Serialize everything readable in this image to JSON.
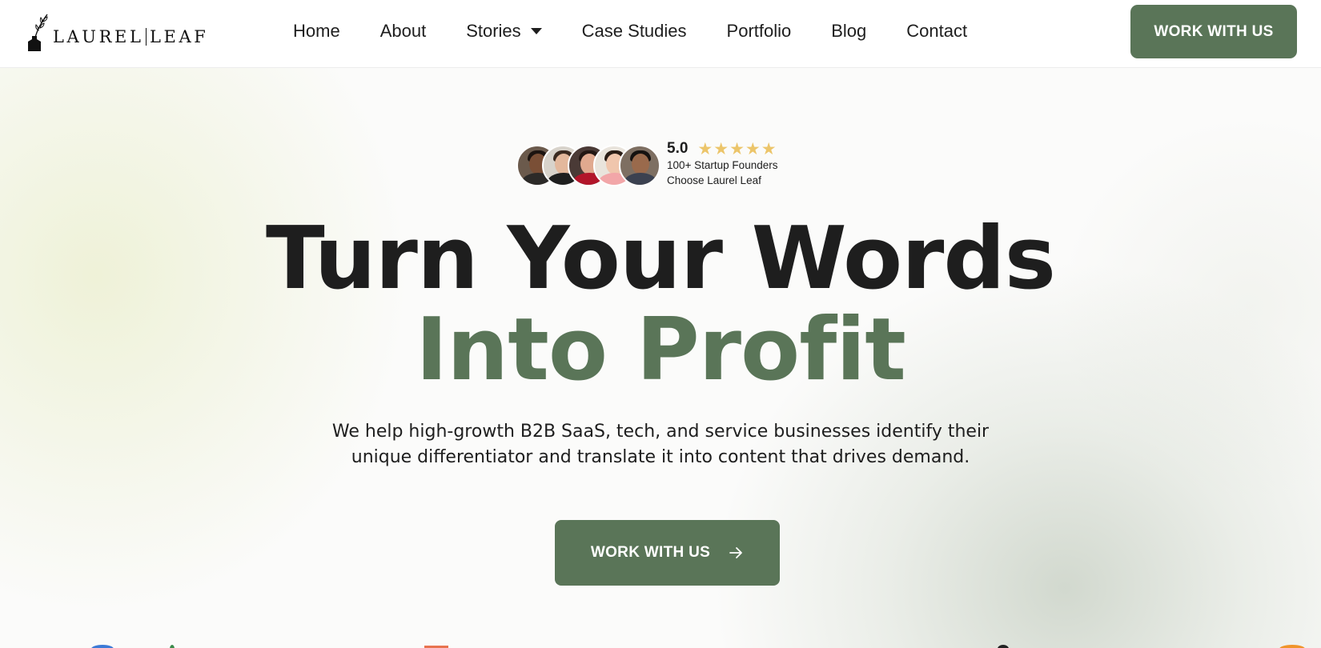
{
  "brand": {
    "name_left": "LAUREL",
    "name_right": "LEAF"
  },
  "nav": {
    "items": [
      {
        "label": "Home"
      },
      {
        "label": "About"
      },
      {
        "label": "Stories"
      },
      {
        "label": "Case Studies"
      },
      {
        "label": "Portfolio"
      },
      {
        "label": "Blog"
      },
      {
        "label": "Contact"
      }
    ]
  },
  "header_cta": {
    "label": "WORK WITH US"
  },
  "rating": {
    "score": "5.0",
    "stars": "★★★★★",
    "line1": "100+ Startup Founders",
    "line2": "Choose Laurel Leaf"
  },
  "hero": {
    "title_line1": "Turn Your Words",
    "title_line2": "Into Profit",
    "subtitle_line1": "We help high-growth B2B SaaS, tech, and service businesses identify their",
    "subtitle_line2": "unique differentiator and translate it into content that drives demand.",
    "cta_label": "WORK WITH US"
  },
  "colors": {
    "accent": "#5a7558",
    "star": "#ecc56a",
    "text": "#1e1e1e"
  },
  "icons": [
    "quill-inkwell-icon",
    "chevron-down-icon",
    "arrow-icon",
    "star-icon"
  ]
}
